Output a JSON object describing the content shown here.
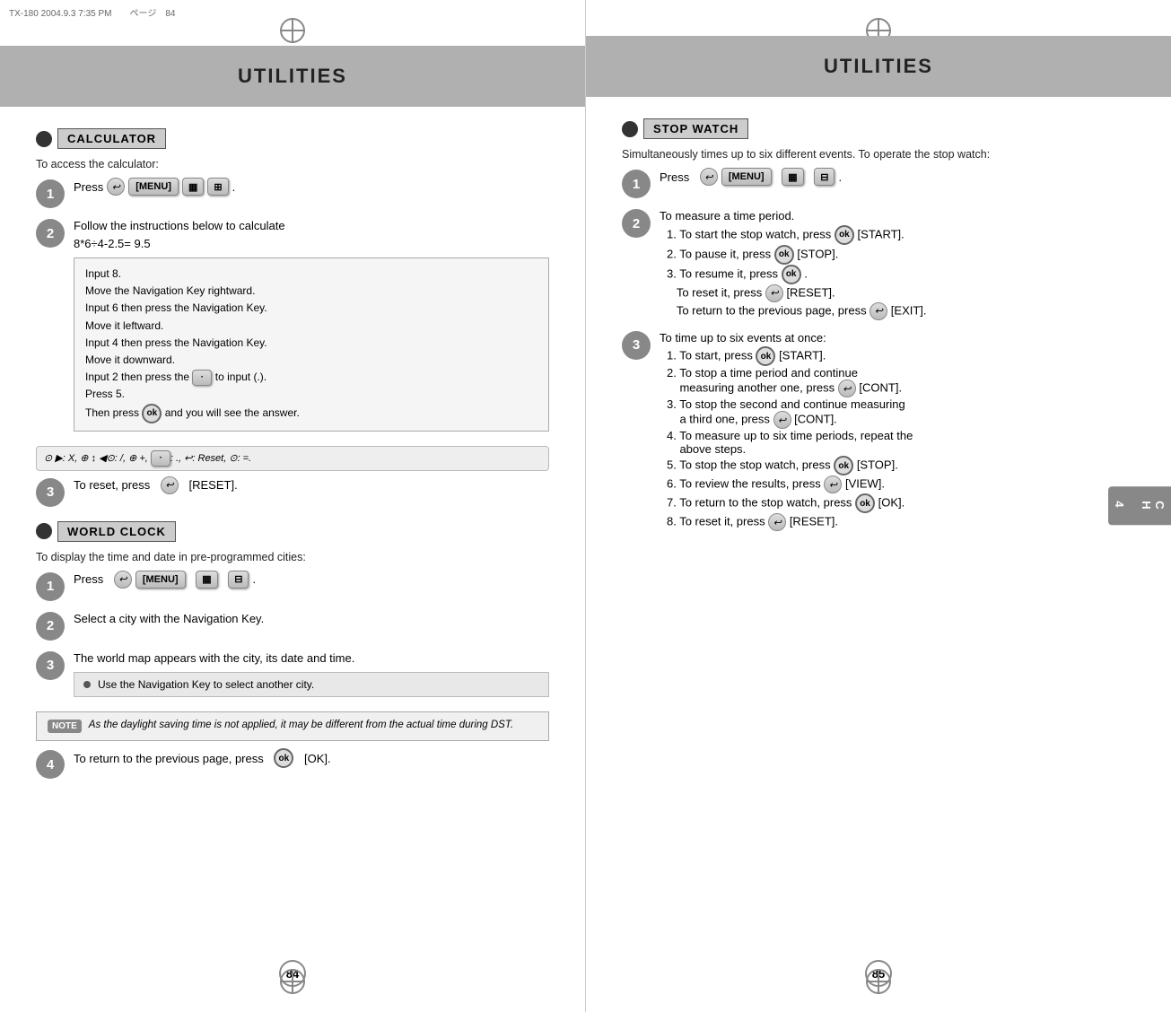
{
  "left_page": {
    "header": "UTILITIES",
    "calculator": {
      "section_title": "CALCULATOR",
      "description": "To access the calculator:",
      "step1_text": "Press",
      "step1_keys": [
        "[MENU]"
      ],
      "step2_text": "Follow the instructions below to calculate",
      "step2_formula": "8*6÷4-2.5= 9.5",
      "instructions": [
        "Input 8.",
        "Move the Navigation Key rightward.",
        "Input 6 then press the Navigation Key.",
        "Move it leftward.",
        "Input 4 then press the Navigation Key.",
        "Move it downward.",
        "Input 2 then press the     to input (.).",
        "Press 5.",
        "Then press      and you will see the answer."
      ],
      "step3_text": "To reset, press",
      "step3_reset": "[RESET]."
    },
    "world_clock": {
      "section_title": "WORLD CLOCK",
      "description": "To display the time and date in pre-programmed cities:",
      "step1_text": "Press",
      "step1_keys": [
        "[MENU]"
      ],
      "step2_text": "Select a city with the Navigation Key.",
      "step3_text": "The world map appears with the city, its date and time.",
      "bullet": "Use the Navigation Key to select another city.",
      "note": "As the daylight saving time is not applied, it may be different from the actual time during DST.",
      "step4_text": "To return to the previous page, press",
      "step4_key": "[OK]."
    },
    "page_number": "84"
  },
  "right_page": {
    "header": "UTILITIES",
    "stopwatch": {
      "section_title": "STOP WATCH",
      "description": "Simultaneously times up to six different events. To operate the stop watch:",
      "step1_text": "Press",
      "step1_keys": [
        "[MENU]"
      ],
      "step2_title": "To measure a time period.",
      "step2_items": [
        "1. To start the stop watch, press      [START].",
        "2. To pause it, press      [STOP].",
        "3. To resume it, press      .",
        "   To reset it, press      [RESET].",
        "   To return to the previous page, press      [EXIT]."
      ],
      "step3_title": "To time up to six events at once:",
      "step3_items": [
        "1. To start, press      [START].",
        "2. To stop a time period and continue measuring another one, press      [CONT].",
        "3. To stop the second and continue measuring a third one, press      [CONT].",
        "4. To measure up to six time periods, repeat the above steps.",
        "5. To stop the stop watch, press      [STOP].",
        "6. To review the results, press      [VIEW].",
        "7. To return to the stop watch, press      [OK].",
        "8. To reset it, press      [RESET]."
      ]
    },
    "page_number": "85"
  },
  "ch_tab": "CH\n4",
  "header_top_text": "TX-180  2004.9.3 7:35 PM　　ページ　84"
}
